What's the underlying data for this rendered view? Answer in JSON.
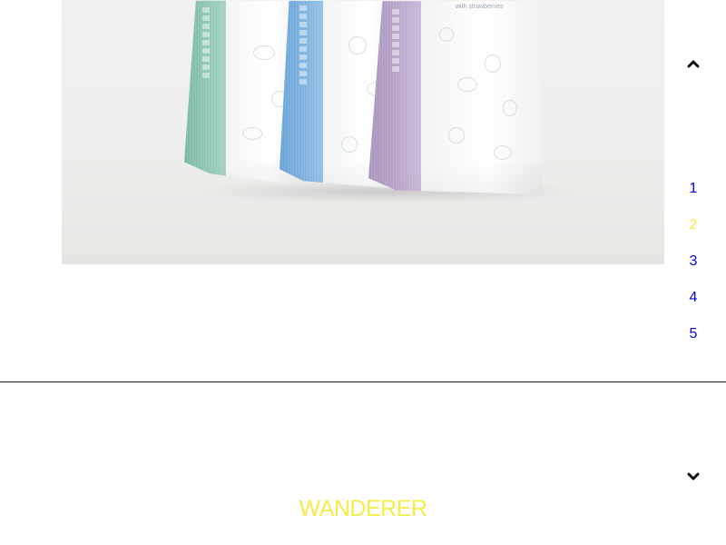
{
  "photo": {
    "alt": "Three paper tea bags: green, blue and purple",
    "bag_label": "with strawberries"
  },
  "navigation": {
    "up_icon": "chevron-up-icon",
    "down_icon": "chevron-down-icon",
    "pages": [
      "1",
      "2",
      "3",
      "4",
      "5"
    ],
    "active_page": "2",
    "link_color": "#0000ee",
    "active_color": "#f2e84a"
  },
  "project": {
    "title": "WANDERER",
    "title_color": "#f4ec4a"
  }
}
